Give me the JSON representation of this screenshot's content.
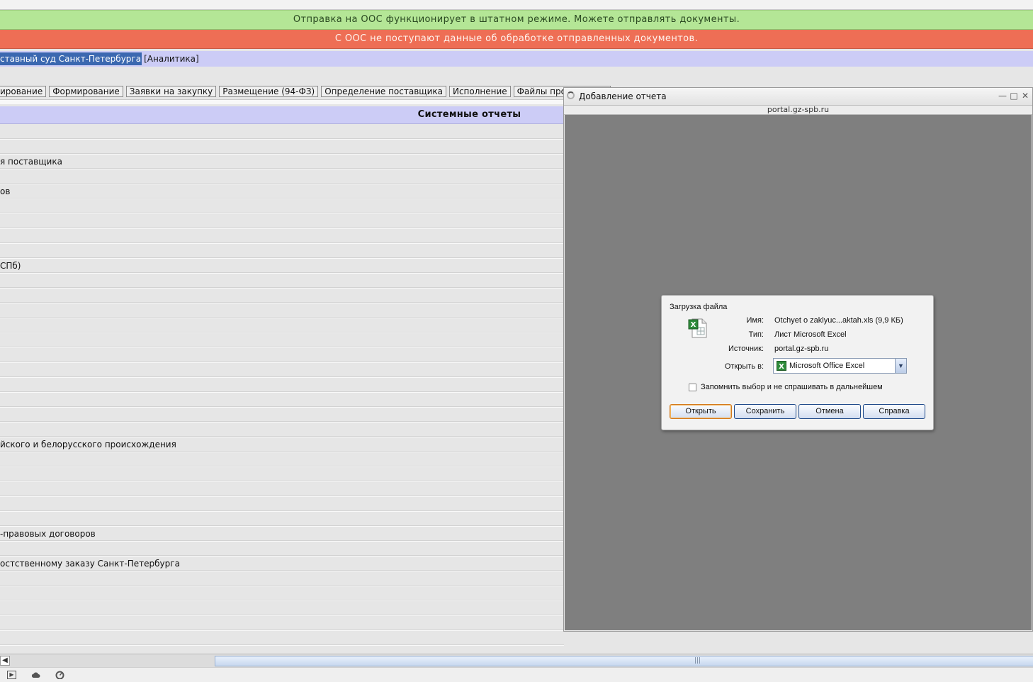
{
  "banners": {
    "ok": "Отправка на ООС функционирует в штатном режиме. Можете отправлять документы.",
    "error": "С ООС не поступают данные об обработке отправленных документов."
  },
  "breadcrumb": {
    "selected": "ставный суд Санкт-Петербурга",
    "link": "[Аналитика]"
  },
  "tabs": [
    "ирование",
    "Формирование",
    "Заявки на закупку",
    "Размещение (94-ФЗ)",
    "Определение поставщика",
    "Исполнение",
    "Файлы произвольно"
  ],
  "section": {
    "title": "Системные отчеты"
  },
  "rows": [
    "",
    "",
    "я поставщика",
    "",
    "ов",
    "",
    "",
    "",
    "",
    "СПб)",
    "",
    "",
    "",
    "",
    "",
    "",
    "",
    "",
    "",
    "",
    "",
    "йского и белорусского происхождения",
    "",
    "",
    "",
    "",
    "",
    "-правовых договоров",
    "",
    "остственному заказу Санкт-Петербурга",
    "",
    "",
    "",
    "",
    ""
  ],
  "window": {
    "title": "Добавление отчета",
    "url": "portal.gz-spb.ru"
  },
  "dialog": {
    "title": "Загрузка файла",
    "fields": {
      "name_label": "Имя:",
      "name_value": "Otchyet o zaklyuc...aktah.xls (9,9 КБ)",
      "type_label": "Тип:",
      "type_value": "Лист Microsoft Excel",
      "source_label": "Источник:",
      "source_value": "portal.gz-spb.ru",
      "open_in_label": "Открыть в:",
      "open_in_value": "Microsoft Office Excel"
    },
    "remember_label": "Запомнить выбор и не спрашивать в дальнейшем",
    "buttons": {
      "open": "Открыть",
      "save": "Сохранить",
      "cancel": "Отмена",
      "help": "Справка"
    }
  },
  "colors": {
    "ok_banner": "#b4e696",
    "error_banner": "#ee6e55",
    "header_lavender": "#ccccf6",
    "selection": "#3b68b0"
  },
  "icons": {
    "excel": "excel-file-icon",
    "spinner": "loading-spinner-icon"
  }
}
